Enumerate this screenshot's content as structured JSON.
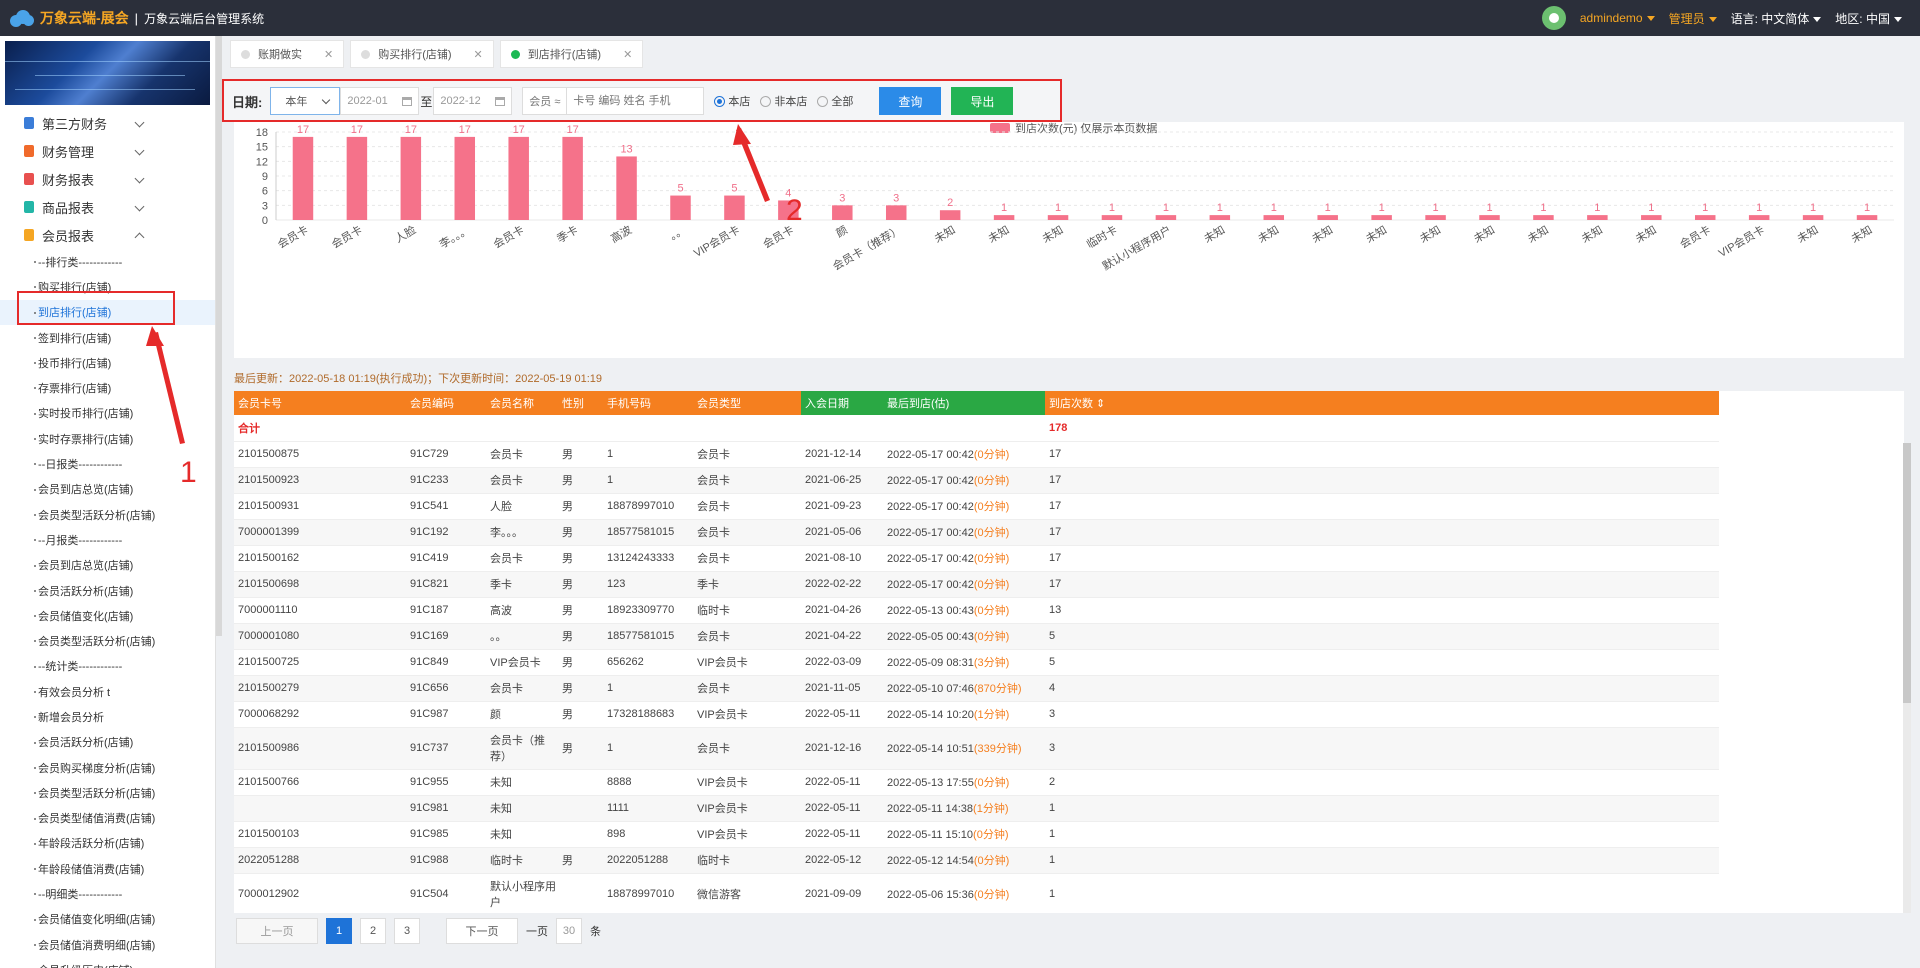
{
  "header": {
    "brand": "万象云端-展会",
    "separator": "|",
    "system": "万象云端后台管理系统",
    "user": "admindemo",
    "role": "管理员",
    "lang_label": "语言:",
    "lang_value": "中文简体",
    "region_label": "地区:",
    "region_value": "中国"
  },
  "sidebar": {
    "groups": [
      {
        "label": "第三方财务",
        "color": "#3b7dd8"
      },
      {
        "label": "财务管理",
        "color": "#f06a2b"
      },
      {
        "label": "财务报表",
        "color": "#e8504f"
      },
      {
        "label": "商品报表",
        "color": "#23b6a7"
      },
      {
        "label": "会员报表",
        "color": "#f5a623"
      }
    ],
    "items": [
      "--排行类------------",
      "购买排行(店铺)",
      "到店排行(店铺)",
      "签到排行(店铺)",
      "投币排行(店铺)",
      "存票排行(店铺)",
      "实时投币排行(店铺)",
      "实时存票排行(店铺)",
      "--日报类------------",
      "会员到店总览(店铺)",
      "会员类型活跃分析(店铺)",
      "--月报类------------",
      "会员到店总览(店铺)",
      "会员活跃分析(店铺)",
      "会员储值变化(店铺)",
      "会员类型活跃分析(店铺)",
      "--统计类------------",
      "有效会员分析 t",
      "新增会员分析",
      "会员活跃分析(店铺)",
      "会员购买梯度分析(店铺)",
      "会员类型活跃分析(店铺)",
      "会员类型储值消费(店铺)",
      "年龄段活跃分析(店铺)",
      "年龄段储值消费(店铺)",
      "--明细类------------",
      "会员储值变化明细(店铺)",
      "会员储值消费明细(店铺)",
      "会员升级历史(店铺)"
    ],
    "active_index": 2
  },
  "tabs": [
    {
      "label": "账期做实",
      "active": false
    },
    {
      "label": "购买排行(店铺)",
      "active": false
    },
    {
      "label": "到店排行(店铺)",
      "active": true
    }
  ],
  "filter": {
    "date_label": "日期:",
    "period": "本年",
    "date_from": "2022-01",
    "to_label": "至",
    "date_to": "2022-12",
    "member_label": "会员 ≈",
    "member_placeholder": "卡号 编码 姓名 手机",
    "radio_store": "本店",
    "radio_other": "非本店",
    "radio_all": "全部",
    "query_button": "查询",
    "export_button": "导出"
  },
  "annotations": {
    "one": "1",
    "two": "2"
  },
  "chart_data": {
    "type": "bar",
    "legend": "到店次数(元) 仅展示本页数据",
    "legend_position": "top-center",
    "color": "#f5728a",
    "ylim": [
      0,
      18
    ],
    "yticks": [
      0,
      3,
      6,
      9,
      12,
      15,
      18
    ],
    "categories": [
      "会员卡",
      "会员卡",
      "人脸",
      "李。。。",
      "会员卡",
      "季卡",
      "高波",
      "。。",
      "VIP会员卡",
      "会员卡",
      "颜",
      "会员卡（推荐）",
      "未知",
      "未知",
      "未知",
      "临时卡",
      "默认小程序用户",
      "未知",
      "未知",
      "未知",
      "未知",
      "未知",
      "未知",
      "未知",
      "未知",
      "未知",
      "会员卡",
      "VIP会员卡",
      "未知",
      "未知"
    ],
    "values": [
      17,
      17,
      17,
      17,
      17,
      17,
      13,
      5,
      5,
      4,
      3,
      3,
      2,
      1,
      1,
      1,
      1,
      1,
      1,
      1,
      1,
      1,
      1,
      1,
      1,
      1,
      1,
      1,
      1,
      1
    ]
  },
  "update_info": "最后更新：2022-05-18 01:19(执行成功)；下次更新时间：2022-05-19 01:19",
  "table": {
    "headers": [
      "会员卡号",
      "会员编码",
      "会员名称",
      "性别",
      "手机号码",
      "会员类型",
      "入会日期",
      "最后到店(估)",
      "到店次数 ⇕"
    ],
    "sum_label": "合计",
    "sum_value": "178",
    "rows": [
      [
        "2101500875",
        "91C729",
        "会员卡",
        "男",
        "1",
        "会员卡",
        "2021-12-14",
        "2022-05-17 00:42",
        "(0分钟)",
        "17"
      ],
      [
        "2101500923",
        "91C233",
        "会员卡",
        "男",
        "1",
        "会员卡",
        "2021-06-25",
        "2022-05-17 00:42",
        "(0分钟)",
        "17"
      ],
      [
        "2101500931",
        "91C541",
        "人脸",
        "男",
        "18878997010",
        "会员卡",
        "2021-09-23",
        "2022-05-17 00:42",
        "(0分钟)",
        "17"
      ],
      [
        "7000001399",
        "91C192",
        "李。。。",
        "男",
        "18577581015",
        "会员卡",
        "2021-05-06",
        "2022-05-17 00:42",
        "(0分钟)",
        "17"
      ],
      [
        "2101500162",
        "91C419",
        "会员卡",
        "男",
        "13124243333",
        "会员卡",
        "2021-08-10",
        "2022-05-17 00:42",
        "(0分钟)",
        "17"
      ],
      [
        "2101500698",
        "91C821",
        "季卡",
        "男",
        "123",
        "季卡",
        "2022-02-22",
        "2022-05-17 00:42",
        "(0分钟)",
        "17"
      ],
      [
        "7000001110",
        "91C187",
        "高波",
        "男",
        "18923309770",
        "临时卡",
        "2021-04-26",
        "2022-05-13 00:43",
        "(0分钟)",
        "13"
      ],
      [
        "7000001080",
        "91C169",
        "。。",
        "男",
        "18577581015",
        "会员卡",
        "2021-04-22",
        "2022-05-05 00:43",
        "(0分钟)",
        "5"
      ],
      [
        "2101500725",
        "91C849",
        "VIP会员卡",
        "男",
        "656262",
        "VIP会员卡",
        "2022-03-09",
        "2022-05-09 08:31",
        "(3分钟)",
        "5"
      ],
      [
        "2101500279",
        "91C656",
        "会员卡",
        "男",
        "1",
        "会员卡",
        "2021-11-05",
        "2022-05-10 07:46",
        "(870分钟)",
        "4"
      ],
      [
        "7000068292",
        "91C987",
        "颜",
        "男",
        "17328188683",
        "VIP会员卡",
        "2022-05-11",
        "2022-05-14 10:20",
        "(1分钟)",
        "3"
      ],
      [
        "2101500986",
        "91C737",
        "会员卡（推荐）",
        "男",
        "1",
        "会员卡",
        "2021-12-16",
        "2022-05-14 10:51",
        "(339分钟)",
        "3"
      ],
      [
        "2101500766",
        "91C955",
        "未知",
        "",
        "8888",
        "VIP会员卡",
        "2022-05-11",
        "2022-05-13 17:55",
        "(0分钟)",
        "2"
      ],
      [
        "",
        "91C981",
        "未知",
        "",
        "1111",
        "VIP会员卡",
        "2022-05-11",
        "2022-05-11 14:38",
        "(1分钟)",
        "1"
      ],
      [
        "2101500103",
        "91C985",
        "未知",
        "",
        "898",
        "VIP会员卡",
        "2022-05-11",
        "2022-05-11 15:10",
        "(0分钟)",
        "1"
      ],
      [
        "2022051288",
        "91C988",
        "临时卡",
        "男",
        "2022051288",
        "临时卡",
        "2022-05-12",
        "2022-05-12 14:54",
        "(0分钟)",
        "1"
      ],
      [
        "7000012902",
        "91C504",
        "默认小程序用户",
        "",
        "18878997010",
        "微信游客",
        "2021-09-09",
        "2022-05-06 15:36",
        "(0分钟)",
        "1"
      ]
    ]
  },
  "pager": {
    "prev": "上一页",
    "pages": [
      "1",
      "2",
      "3"
    ],
    "next": "下一页",
    "per_page_label": "一页",
    "per_page": "30",
    "unit": "条"
  }
}
